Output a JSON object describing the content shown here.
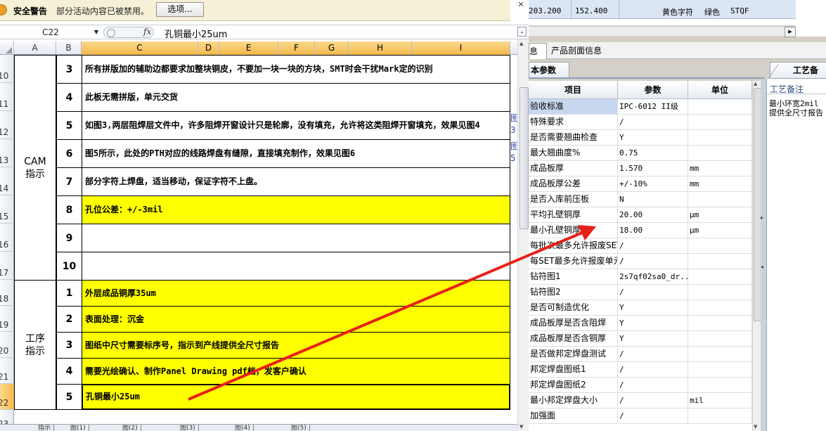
{
  "security_bar": {
    "title": "安全警告",
    "message": "部分活动内容已被禁用。",
    "options_button": "选项..."
  },
  "window": {
    "close_glyph": "✕"
  },
  "formula_bar": {
    "name_box": "C22",
    "formula": "孔铜最小25um"
  },
  "columns": [
    "A",
    "B",
    "C",
    "D",
    "E",
    "F",
    "G",
    "H",
    "I"
  ],
  "rows": [
    "10",
    "11",
    "12",
    "13",
    "14",
    "15",
    "16",
    "17",
    "18",
    "19",
    "20",
    "21",
    "22",
    "23"
  ],
  "sections": {
    "cam": "CAM\n指示",
    "process": "工序\n指示"
  },
  "cam_items": [
    {
      "num": "3",
      "text": "所有拼版加的辅助边都要求加整块铜皮，不要加一块一块的方块，SMT时会干扰Mark定的识别",
      "side": ""
    },
    {
      "num": "4",
      "text": "此板无需拼版，单元交货",
      "side": ""
    },
    {
      "num": "5",
      "text": "如图3,两层阻焊层文件中，许多阻焊开窗设计只是轮廓，没有填充，允许将这类阻焊开窗填充，效果见图4",
      "side": "图3"
    },
    {
      "num": "6",
      "text": "图5所示，此处的PTH对应的线路焊盘有缝隙，直接填充制作，效果见图6",
      "side": "图5"
    },
    {
      "num": "7",
      "text": "部分字符上焊盘，适当移动，保证字符不上盘。",
      "side": ""
    },
    {
      "num": "8",
      "text": "孔位公差：+/-3mil",
      "side": ""
    },
    {
      "num": "9",
      "text": "",
      "side": ""
    },
    {
      "num": "10",
      "text": "",
      "side": ""
    }
  ],
  "process_items": [
    {
      "num": "1",
      "text": "外层成品铜厚35um"
    },
    {
      "num": "2",
      "text": "表面处理：沉金"
    },
    {
      "num": "3",
      "text": "图纸中尺寸需要标序号，指示到产线提供全尺寸报告"
    },
    {
      "num": "4",
      "text": "需要光绘确认、制作Panel Drawing pdf档，发客户确认"
    },
    {
      "num": "5",
      "text": "孔铜最小25um"
    }
  ],
  "sheet_tabs": [
    "指示",
    "图(1)",
    "图(2)",
    "图(3)",
    "图(4)",
    "图(5)"
  ],
  "top_grid": {
    "v1": "203.200",
    "v2": "152.400",
    "v3": "黄色字符",
    "v4": "绿色",
    "v5": "STQF"
  },
  "tabs": {
    "info": "息",
    "profile": "产品剖面信息"
  },
  "params_panel": {
    "tab": "本参数",
    "headers": [
      "项目",
      "参数",
      "单位"
    ],
    "rows": [
      {
        "item": "验收标准",
        "value": "IPC-6012 II级",
        "unit": ""
      },
      {
        "item": "特殊要求",
        "value": "/",
        "unit": ""
      },
      {
        "item": "是否需要翘曲检查",
        "value": "Y",
        "unit": ""
      },
      {
        "item": "最大翘曲度%",
        "value": "0.75",
        "unit": ""
      },
      {
        "item": "成品板厚",
        "value": "1.570",
        "unit": "mm"
      },
      {
        "item": "成品板厚公差",
        "value": "+/-10%",
        "unit": "mm"
      },
      {
        "item": "是否入库前压板",
        "value": "N",
        "unit": ""
      },
      {
        "item": "平均孔壁铜厚",
        "value": "20.00",
        "unit": "μm"
      },
      {
        "item": "最小孔壁铜厚",
        "value": "18.00",
        "unit": "μm"
      },
      {
        "item": "每批次最多允许报废SET",
        "value": "/",
        "unit": ""
      },
      {
        "item": "每SET最多允许报废单元",
        "value": "/",
        "unit": ""
      },
      {
        "item": "钻符图1",
        "value": "2s7qf02sa0_dr...",
        "unit": ""
      },
      {
        "item": "钻符图2",
        "value": "/",
        "unit": ""
      },
      {
        "item": "是否可制造优化",
        "value": "Y",
        "unit": ""
      },
      {
        "item": "成品板厚是否含阻焊",
        "value": "Y",
        "unit": ""
      },
      {
        "item": "成品板厚是否含铜厚",
        "value": "Y",
        "unit": ""
      },
      {
        "item": "是否做邦定焊盘测试",
        "value": "/",
        "unit": ""
      },
      {
        "item": "邦定焊盘图纸1",
        "value": "/",
        "unit": ""
      },
      {
        "item": "邦定焊盘图纸2",
        "value": "/",
        "unit": ""
      },
      {
        "item": "最小邦定焊盘大小",
        "value": "/",
        "unit": "mil"
      },
      {
        "item": "加强面",
        "value": "/",
        "unit": ""
      }
    ]
  },
  "notes_panel": {
    "tab": "工艺备注",
    "title": "工艺备注",
    "lines": [
      "最小环宽2mil",
      "提供全尺寸报告"
    ]
  },
  "colors": {
    "highlight": "#ffff00",
    "arrow": "#e8201a",
    "selection_header": "#f6c35e"
  }
}
